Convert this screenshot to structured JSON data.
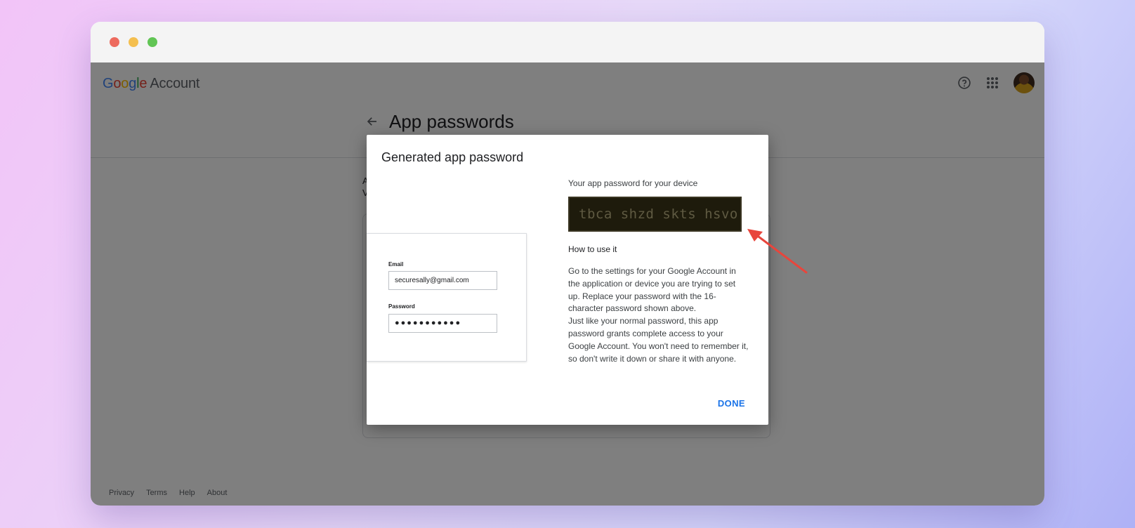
{
  "header": {
    "logo": {
      "G": "G",
      "o1": "o",
      "o2": "o",
      "g": "g",
      "l": "l",
      "e": "e",
      "account": "Account"
    },
    "page_title": "App passwords"
  },
  "background": {
    "text_line1": "A",
    "text_line2": "V"
  },
  "footer": {
    "links": [
      "Privacy",
      "Terms",
      "Help",
      "About"
    ]
  },
  "dialog": {
    "title": "Generated app password",
    "illustration": {
      "email_label": "Email",
      "email_value": "securesally@gmail.com",
      "password_label": "Password",
      "password_value": "●●●●●●●●●●●"
    },
    "password_label": "Your app password for your device",
    "app_password": "tbca shzd skts hsvo",
    "howto_label": "How to use it",
    "howto_text1": "Go to the settings for your Google Account in the application or device you are trying to set up. Replace your password with the 16-character password shown above.",
    "howto_text2": "Just like your normal password, this app password grants complete access to your Google Account. You won't need to remember it, so don't write it down or share it with anyone.",
    "done_label": "DONE"
  },
  "colors": {
    "accent": "#1a73e8",
    "annotation_arrow": "#e8453c"
  }
}
